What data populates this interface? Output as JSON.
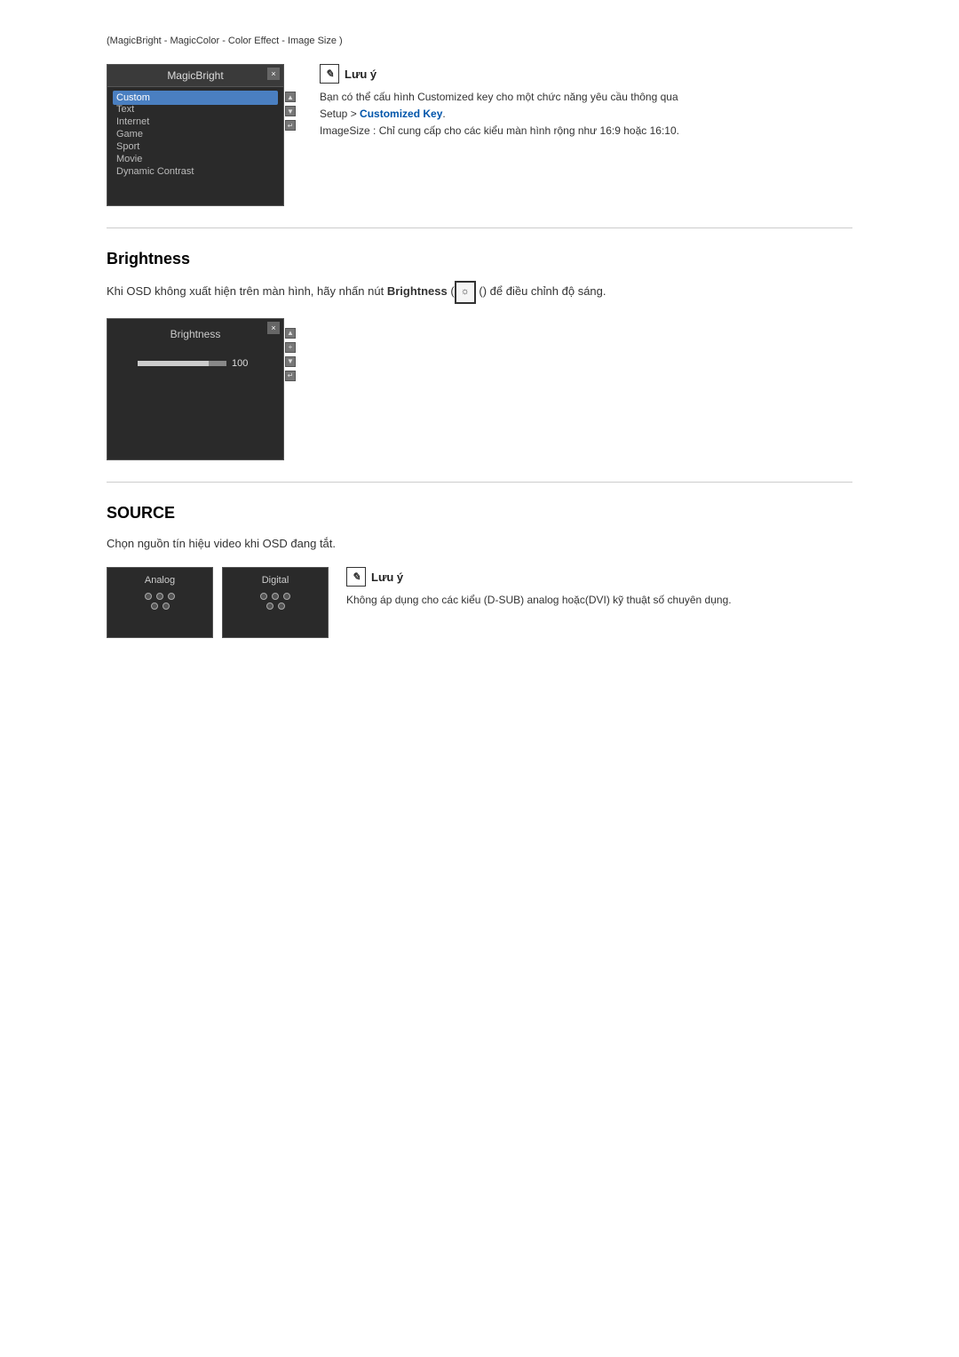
{
  "breadcrumb": {
    "text": "(MagicBright - MagicColor - Color Effect - Image Size )",
    "links": [
      "MagicBright",
      "MagicColor",
      "Color Effect",
      "Image Size"
    ]
  },
  "osd1": {
    "title": "MagicBright",
    "close_label": "×",
    "items": [
      "Custom",
      "Text",
      "Internet",
      "Game",
      "Sport",
      "Movie",
      "Dynamic Contrast"
    ],
    "selected_index": 0
  },
  "note1": {
    "icon_label": "✎",
    "title": "Lưu ý",
    "line1": "Bạn có thể cấu hình Customized key cho một chức năng yêu cầu thông qua",
    "line2_prefix": "Setup > ",
    "line2_link": "Customized Key",
    "line2_suffix": ".",
    "line3": "ImageSize : Chỉ cung cấp cho các kiểu màn hình rộng như 16:9 hoặc 16:10."
  },
  "brightness_section": {
    "title": "Brightness",
    "body_prefix": "Khi OSD không xuất hiện trên màn hình, hãy nhấn nút ",
    "body_link": "Brightness",
    "body_suffix": " (",
    "body_end": ") để điều chỉnh độ sáng.",
    "btn_icon_label": "☼",
    "osd": {
      "title": "Brightness",
      "close_label": "×",
      "value": "100",
      "slider_fill_percent": 80
    }
  },
  "source_section": {
    "title": "SOURCE",
    "body": "Chọn nguồn tín hiệu video khi OSD đang tắt.",
    "analog_label": "Analog",
    "digital_label": "Digital",
    "note": {
      "icon_label": "✎",
      "title": "Lưu ý",
      "text": "Không áp dụng cho các kiểu (D-SUB) analog hoặc(DVI) kỹ thuật số chuyên dụng."
    }
  }
}
